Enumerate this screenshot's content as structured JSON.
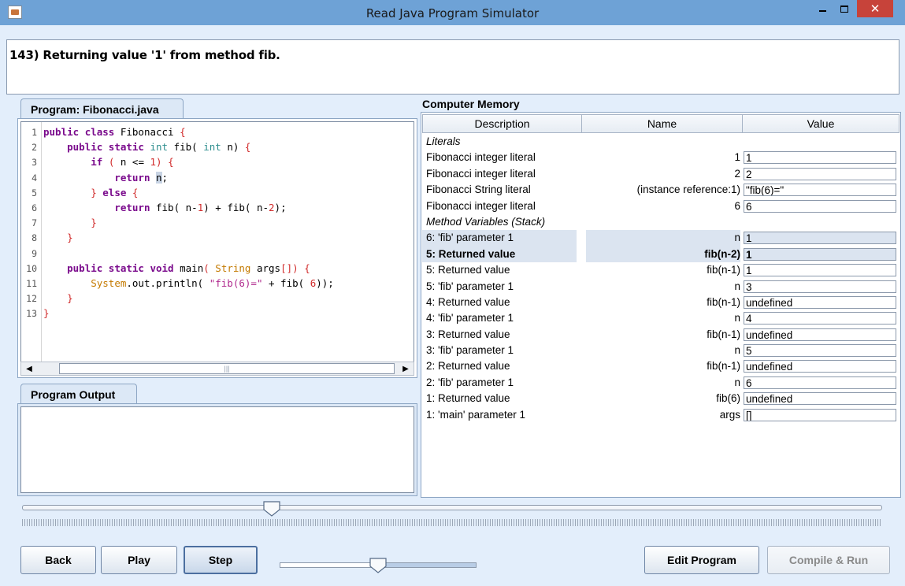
{
  "window": {
    "title": "Read Java Program Simulator",
    "close_glyph": "✕"
  },
  "status": {
    "message": "143) Returning value '1' from method fib."
  },
  "program": {
    "tab_label": "Program: Fibonacci.java",
    "line_numbers": [
      "1",
      "2",
      "3",
      "4",
      "5",
      "6",
      "7",
      "8",
      "9",
      "10",
      "11",
      "12",
      "13"
    ]
  },
  "output": {
    "tab_label": "Program Output"
  },
  "memory": {
    "title": "Computer Memory",
    "columns": {
      "description": "Description",
      "name": "Name",
      "value": "Value"
    },
    "literals_heading": "Literals",
    "literals": [
      {
        "description": "Fibonacci integer literal",
        "name": "1",
        "value": "1"
      },
      {
        "description": "Fibonacci integer literal",
        "name": "2",
        "value": "2"
      },
      {
        "description": "Fibonacci String literal",
        "name": "(instance reference:1)",
        "value": "\"fib(6)=\""
      },
      {
        "description": "Fibonacci integer literal",
        "name": "6",
        "value": "6"
      }
    ],
    "stack_heading": "Method Variables (Stack)",
    "stack": [
      {
        "description": "6: 'fib'  parameter 1",
        "name": "n",
        "value": "1"
      },
      {
        "description": "5: Returned value",
        "name": "fib(n-2)",
        "value": "1"
      },
      {
        "description": "5: Returned value",
        "name": "fib(n-1)",
        "value": "1"
      },
      {
        "description": "5: 'fib'  parameter 1",
        "name": "n",
        "value": "3"
      },
      {
        "description": "4: Returned value",
        "name": "fib(n-1)",
        "value": "undefined"
      },
      {
        "description": "4: 'fib'  parameter 1",
        "name": "n",
        "value": "4"
      },
      {
        "description": "3: Returned value",
        "name": "fib(n-1)",
        "value": "undefined"
      },
      {
        "description": "3: 'fib'  parameter 1",
        "name": "n",
        "value": "5"
      },
      {
        "description": "2: Returned value",
        "name": "fib(n-1)",
        "value": "undefined"
      },
      {
        "description": "2: 'fib'  parameter 1",
        "name": "n",
        "value": "6"
      },
      {
        "description": "1: Returned value",
        "name": "fib(6)",
        "value": "undefined"
      },
      {
        "description": "1: 'main'  parameter 1",
        "name": "args",
        "value": "[]"
      }
    ]
  },
  "controls": {
    "back": "Back",
    "play": "Play",
    "step": "Step",
    "edit": "Edit Program",
    "compile": "Compile & Run",
    "timeline_position": 0.29,
    "speed_position": 0.5
  },
  "icons": {
    "app": "java-app-icon",
    "minimize": "minimize-icon",
    "maximize": "maximize-icon",
    "close": "close-icon",
    "scroll_left": "arrow-left-icon",
    "scroll_right": "arrow-right-icon"
  },
  "colors": {
    "titlebar": "#6ea2d6",
    "close": "#c7433a",
    "keyword": "#7a0a8c",
    "string": "#b02a8e",
    "type": "#2f8f8f"
  }
}
